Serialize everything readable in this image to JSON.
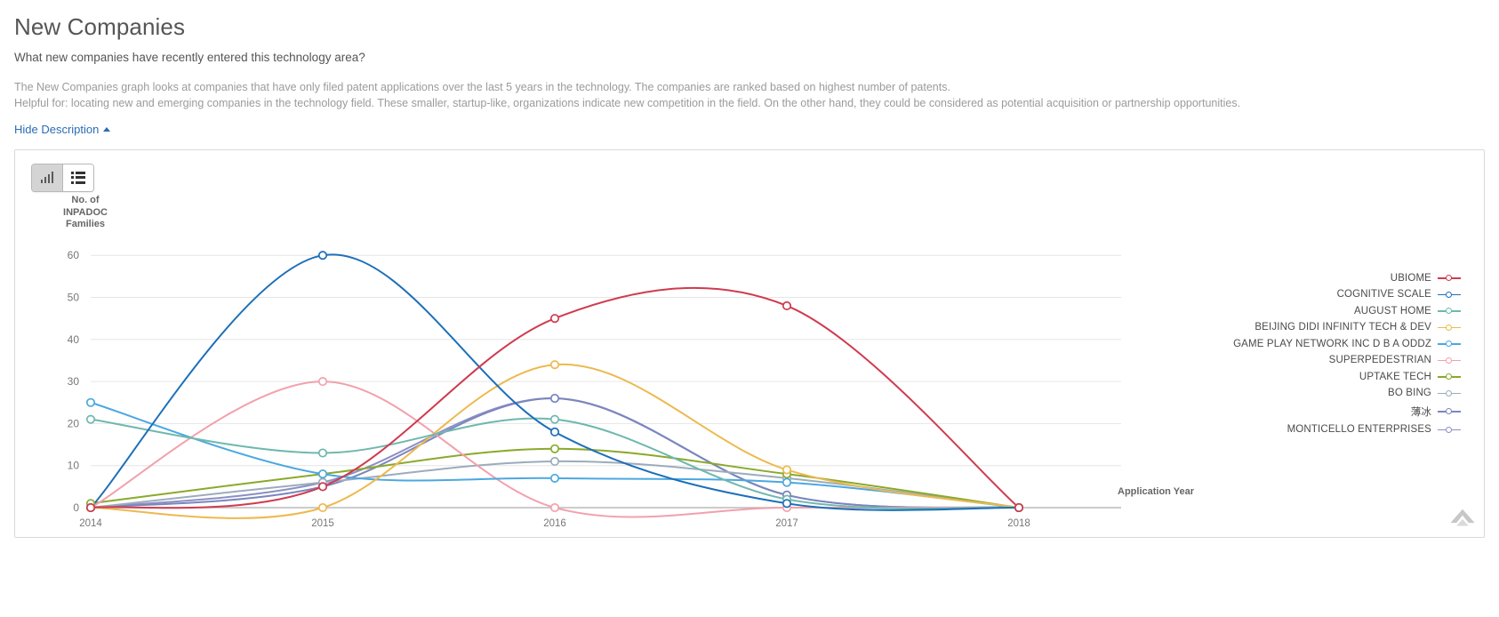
{
  "header": {
    "title": "New Companies",
    "subtitle": "What new companies have recently entered this technology area?",
    "description_line1": "The New Companies graph looks at companies that have only filed patent applications over the last 5 years in the technology. The companies are ranked based on highest number of patents.",
    "description_line2": "Helpful for: locating new and emerging companies in the technology field. These smaller, startup-like, organizations indicate new competition in the field. On the other hand, they could be considered as potential acquisition or partnership opportunities.",
    "hide_description_label": "Hide Description"
  },
  "toolbar": {
    "chart_view_icon": "bar-chart-icon",
    "table_view_icon": "list-icon",
    "active_view": "chart"
  },
  "chart_data": {
    "type": "line",
    "title": "",
    "xlabel": "Application Year",
    "ylabel": "No. of INPADOC Families",
    "x": [
      2014,
      2015,
      2016,
      2017,
      2018
    ],
    "xtick_labels": [
      "2014",
      "2015",
      "2016",
      "2017",
      "2018"
    ],
    "ytick_labels": [
      "0",
      "10",
      "20",
      "30",
      "40",
      "50",
      "60"
    ],
    "yticks": [
      0,
      10,
      20,
      30,
      40,
      50,
      60
    ],
    "ylim": [
      0,
      63
    ],
    "grid": true,
    "legend_position": "right",
    "series": [
      {
        "name": "UBIOME",
        "color": "#cf3b4f",
        "values": [
          0,
          5,
          45,
          48,
          0
        ]
      },
      {
        "name": "COGNITIVE SCALE",
        "color": "#1d6fb8",
        "values": [
          0,
          60,
          18,
          1,
          0
        ]
      },
      {
        "name": "AUGUST HOME",
        "color": "#6fb8ae",
        "values": [
          21,
          13,
          21,
          2,
          0
        ]
      },
      {
        "name": "BEIJING DIDI INFINITY TECH & DEV",
        "color": "#edb94e",
        "values": [
          0,
          0,
          34,
          9,
          0
        ]
      },
      {
        "name": "GAME PLAY NETWORK INC D B A ODDZ",
        "color": "#4ba8e0",
        "values": [
          25,
          8,
          7,
          6,
          0
        ]
      },
      {
        "name": "SUPERPEDESTRIAN",
        "color": "#f2a0ac",
        "values": [
          0,
          30,
          0,
          0,
          0
        ]
      },
      {
        "name": "UPTAKE TECH",
        "color": "#8aa92b",
        "values": [
          1,
          8,
          14,
          8,
          0
        ]
      },
      {
        "name": "BO BING",
        "color": "#9bacbb",
        "values": [
          0,
          6,
          11,
          7,
          0
        ]
      },
      {
        "name": "薄冰",
        "color": "#7b86bd",
        "values": [
          0,
          5,
          26,
          3,
          0
        ]
      },
      {
        "name": "MONTICELLO ENTERPRISES",
        "color": "#8d8fc4",
        "values": [
          0,
          6,
          26,
          3,
          0
        ]
      }
    ]
  },
  "watermark": {
    "name": "corner-logo"
  }
}
